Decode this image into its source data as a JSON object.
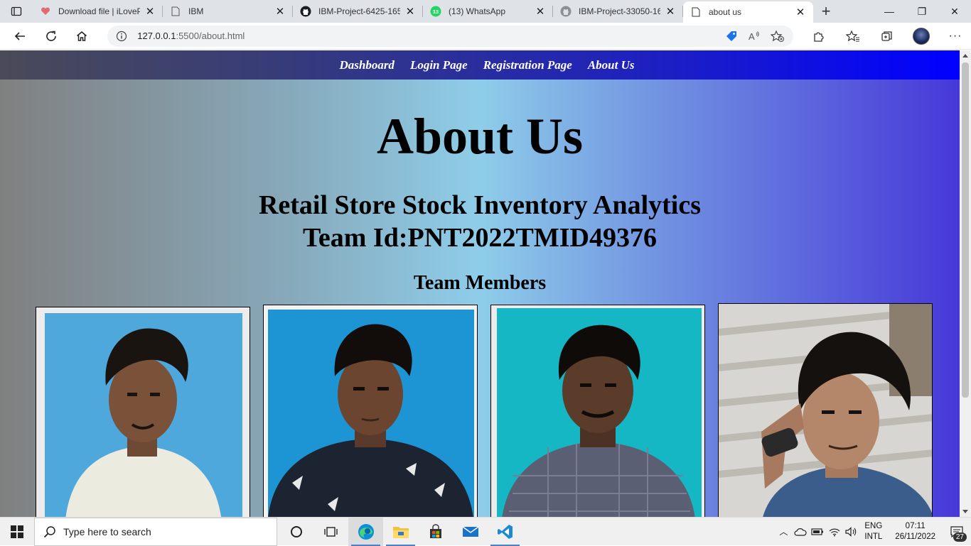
{
  "browser": {
    "tabs": [
      {
        "label": "Download file | iLoveP",
        "favicon": "heart-icon"
      },
      {
        "label": "IBM",
        "favicon": "page-icon"
      },
      {
        "label": "IBM-Project-6425-165",
        "favicon": "github-icon"
      },
      {
        "label": "(13) WhatsApp",
        "favicon": "whatsapp-icon",
        "badge": "13"
      },
      {
        "label": "IBM-Project-33050-16",
        "favicon": "github-icon"
      },
      {
        "label": "about us",
        "favicon": "page-icon",
        "active": true
      }
    ],
    "url_host": "127.0.0.1",
    "url_path": ":5500/about.html"
  },
  "page": {
    "nav": [
      "Dashboard",
      "Login Page",
      "Registration Page",
      "About Us"
    ],
    "title": "About Us",
    "project": "Retail Store Stock Inventory Analytics",
    "team_id": "Team Id:PNT2022TMID49376",
    "members_heading": "Team Members"
  },
  "taskbar": {
    "search_placeholder": "Type here to search",
    "lang_top": "ENG",
    "lang_bottom": "INTL",
    "time": "07:11",
    "date": "26/11/2022",
    "notification_count": "27"
  },
  "colors": {
    "nav_gradient_end": "#0000ff",
    "page_gradient_mid": "#8ecde9",
    "page_gradient_end": "#4738d9"
  }
}
